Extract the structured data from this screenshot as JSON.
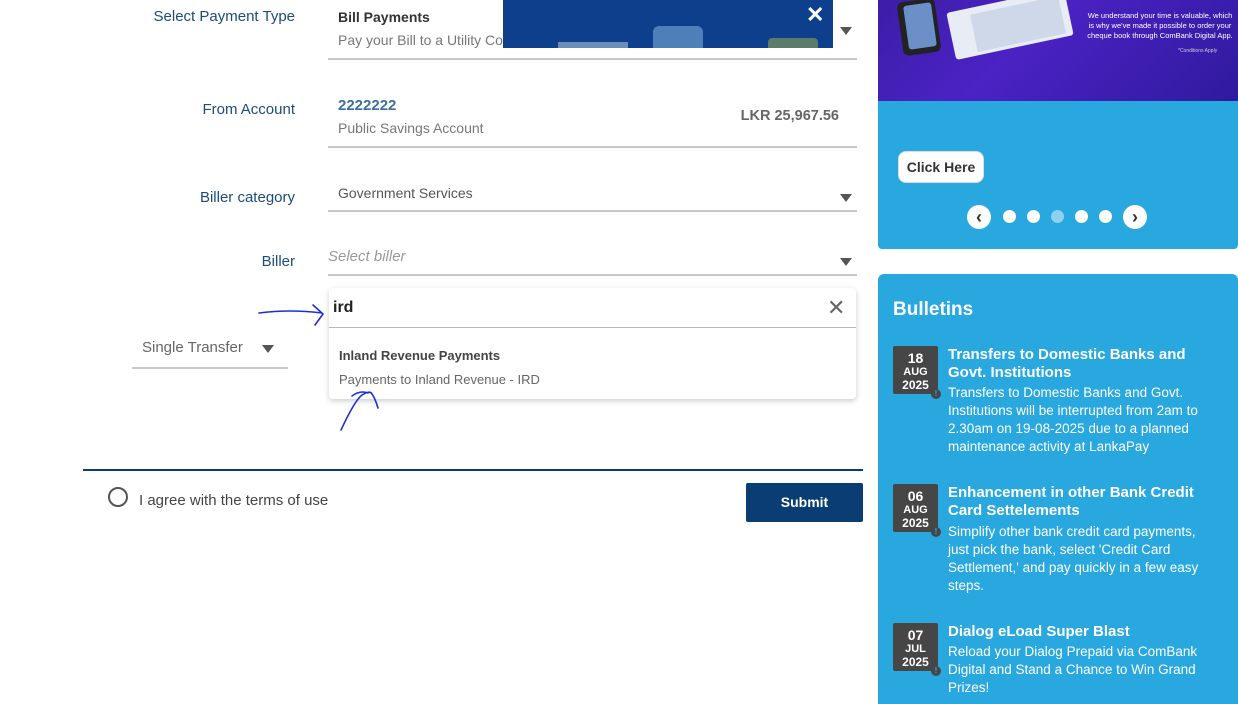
{
  "form": {
    "payment_type_label": "Select Payment Type",
    "payment_type_value": "Bill Payments",
    "payment_type_desc": "Pay your Bill to a Utility Con",
    "from_account_label": "From Account",
    "account_number": "2222222",
    "account_type": "Public Savings Account",
    "account_balance": "LKR 25,967.56",
    "biller_category_label": "Biller category",
    "biller_category_value": "Government Services",
    "biller_label": "Biller",
    "biller_placeholder": "Select biller",
    "search_value": "ird",
    "result_title": "Inland Revenue Payments",
    "result_desc": "Payments to Inland Revenue - IRD",
    "transfer_type": "Single Transfer",
    "terms_label": "I agree with the terms of use",
    "submit_label": "Submit"
  },
  "promo": {
    "banner_text": "We understand your time is valuable, which is why we've made it possible to order your cheque book through ComBank Digital App.",
    "banner_footnote": "*Conditions Apply",
    "click_here": "Click Here",
    "active_slide": 3,
    "slide_count": 5
  },
  "bulletins": {
    "heading": "Bulletins",
    "items": [
      {
        "day": "18",
        "month": "AUG",
        "year": "2025",
        "title": "Transfers to Domestic Banks and Govt. Institutions",
        "body": "Transfers to Domestic Banks and Govt. Institutions will be interrupted from 2am to 2.30am on 19-08-2025 due to a planned maintenance activity at LankaPay"
      },
      {
        "day": "06",
        "month": "AUG",
        "year": "2025",
        "title": "Enhancement in other Bank Credit Card Settelements",
        "body": "Simplify other bank credit card payments, just pick the bank, select 'Credit Card Settlement,' and pay quickly in a few easy steps."
      },
      {
        "day": "07",
        "month": "JUL",
        "year": "2025",
        "title": "Dialog eLoad Super Blast",
        "body": "Reload your Dialog Prepaid via ComBank Digital and Stand a Chance to Win Grand Prizes!"
      }
    ]
  },
  "colors": {
    "primary": "#0a3d73",
    "panel_blue": "#29a8e0",
    "label_blue": "#1c4b7c",
    "annotation": "#1a2fd6"
  }
}
